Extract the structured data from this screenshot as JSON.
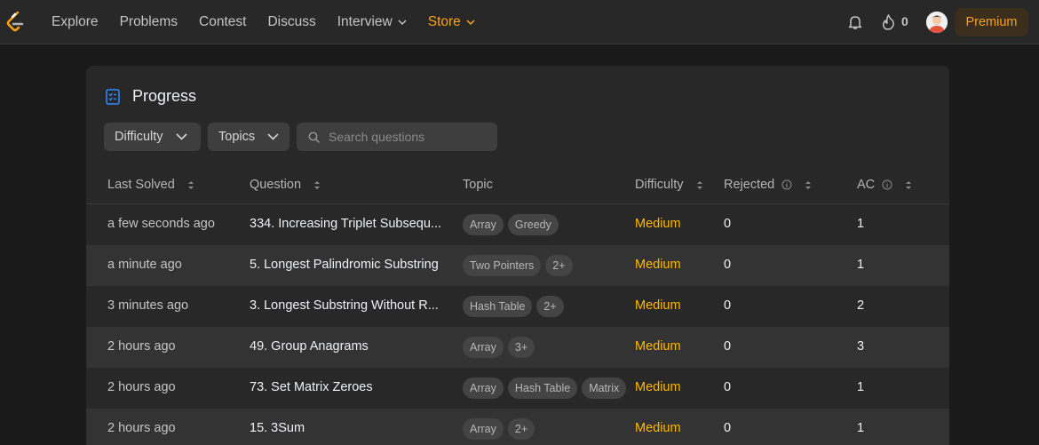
{
  "nav": {
    "links": [
      "Explore",
      "Problems",
      "Contest",
      "Discuss"
    ],
    "interview": "Interview",
    "store": "Store",
    "streak": "0",
    "premium": "Premium"
  },
  "card": {
    "title": "Progress",
    "filters": {
      "difficulty": "Difficulty",
      "topics": "Topics",
      "search_placeholder": "Search questions"
    },
    "headers": {
      "last_solved": "Last Solved",
      "question": "Question",
      "topic": "Topic",
      "difficulty": "Difficulty",
      "rejected": "Rejected",
      "ac": "AC"
    },
    "rows": [
      {
        "last": "a few seconds ago",
        "question": "334. Increasing Triplet Subsequ...",
        "tags": [
          "Array",
          "Greedy"
        ],
        "difficulty": "Medium",
        "rejected": "0",
        "ac": "1"
      },
      {
        "last": "a minute ago",
        "question": "5. Longest Palindromic Substring",
        "tags": [
          "Two Pointers",
          "2+"
        ],
        "difficulty": "Medium",
        "rejected": "0",
        "ac": "1"
      },
      {
        "last": "3 minutes ago",
        "question": "3. Longest Substring Without R...",
        "tags": [
          "Hash Table",
          "2+"
        ],
        "difficulty": "Medium",
        "rejected": "0",
        "ac": "2"
      },
      {
        "last": "2 hours ago",
        "question": "49. Group Anagrams",
        "tags": [
          "Array",
          "3+"
        ],
        "difficulty": "Medium",
        "rejected": "0",
        "ac": "3"
      },
      {
        "last": "2 hours ago",
        "question": "73. Set Matrix Zeroes",
        "tags": [
          "Array",
          "Hash Table",
          "Matrix"
        ],
        "difficulty": "Medium",
        "rejected": "0",
        "ac": "1"
      },
      {
        "last": "2 hours ago",
        "question": "15. 3Sum",
        "tags": [
          "Array",
          "2+"
        ],
        "difficulty": "Medium",
        "rejected": "0",
        "ac": "1"
      }
    ]
  },
  "colors": {
    "accent": "#ffa116",
    "medium": "#ffb800",
    "bg": "#1a1a1a",
    "card": "#282828"
  }
}
